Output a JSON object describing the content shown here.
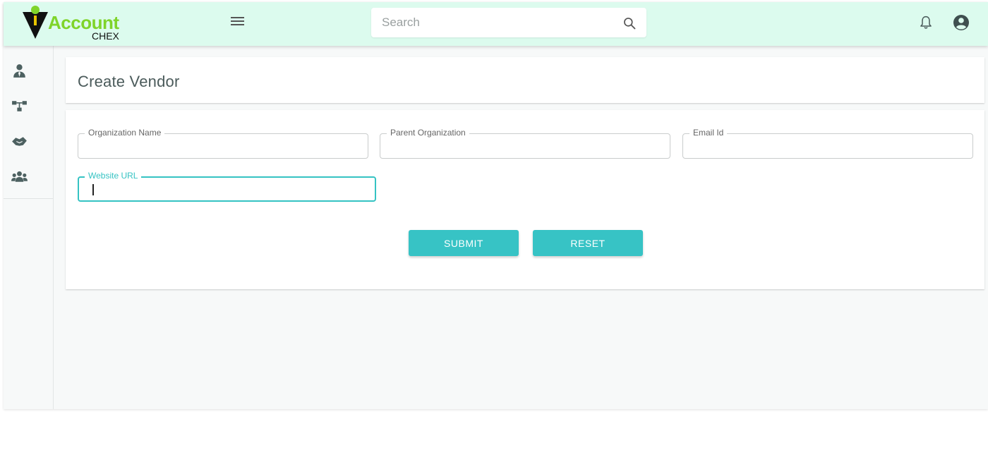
{
  "brand": {
    "name_main": "Account",
    "name_sub": "CHEX"
  },
  "header": {
    "search_placeholder": "Search",
    "search_value": ""
  },
  "sidebar": {
    "items": [
      {
        "icon": "user-tie-icon"
      },
      {
        "icon": "sitemap-icon"
      },
      {
        "icon": "handshake-icon"
      },
      {
        "icon": "users-icon"
      }
    ]
  },
  "page": {
    "title": "Create Vendor"
  },
  "form": {
    "fields": {
      "organization_name": {
        "label": "Organization Name",
        "value": ""
      },
      "parent_organization": {
        "label": "Parent Organization",
        "value": ""
      },
      "email_id": {
        "label": "Email Id",
        "value": ""
      },
      "website_url": {
        "label": "Website URL",
        "value": ""
      }
    },
    "submit_label": "SUBMIT",
    "reset_label": "RESET"
  },
  "colors": {
    "topbar_bg": "#dcfbee",
    "accent": "#37c3c5",
    "logo_green": "#7fd42a"
  }
}
